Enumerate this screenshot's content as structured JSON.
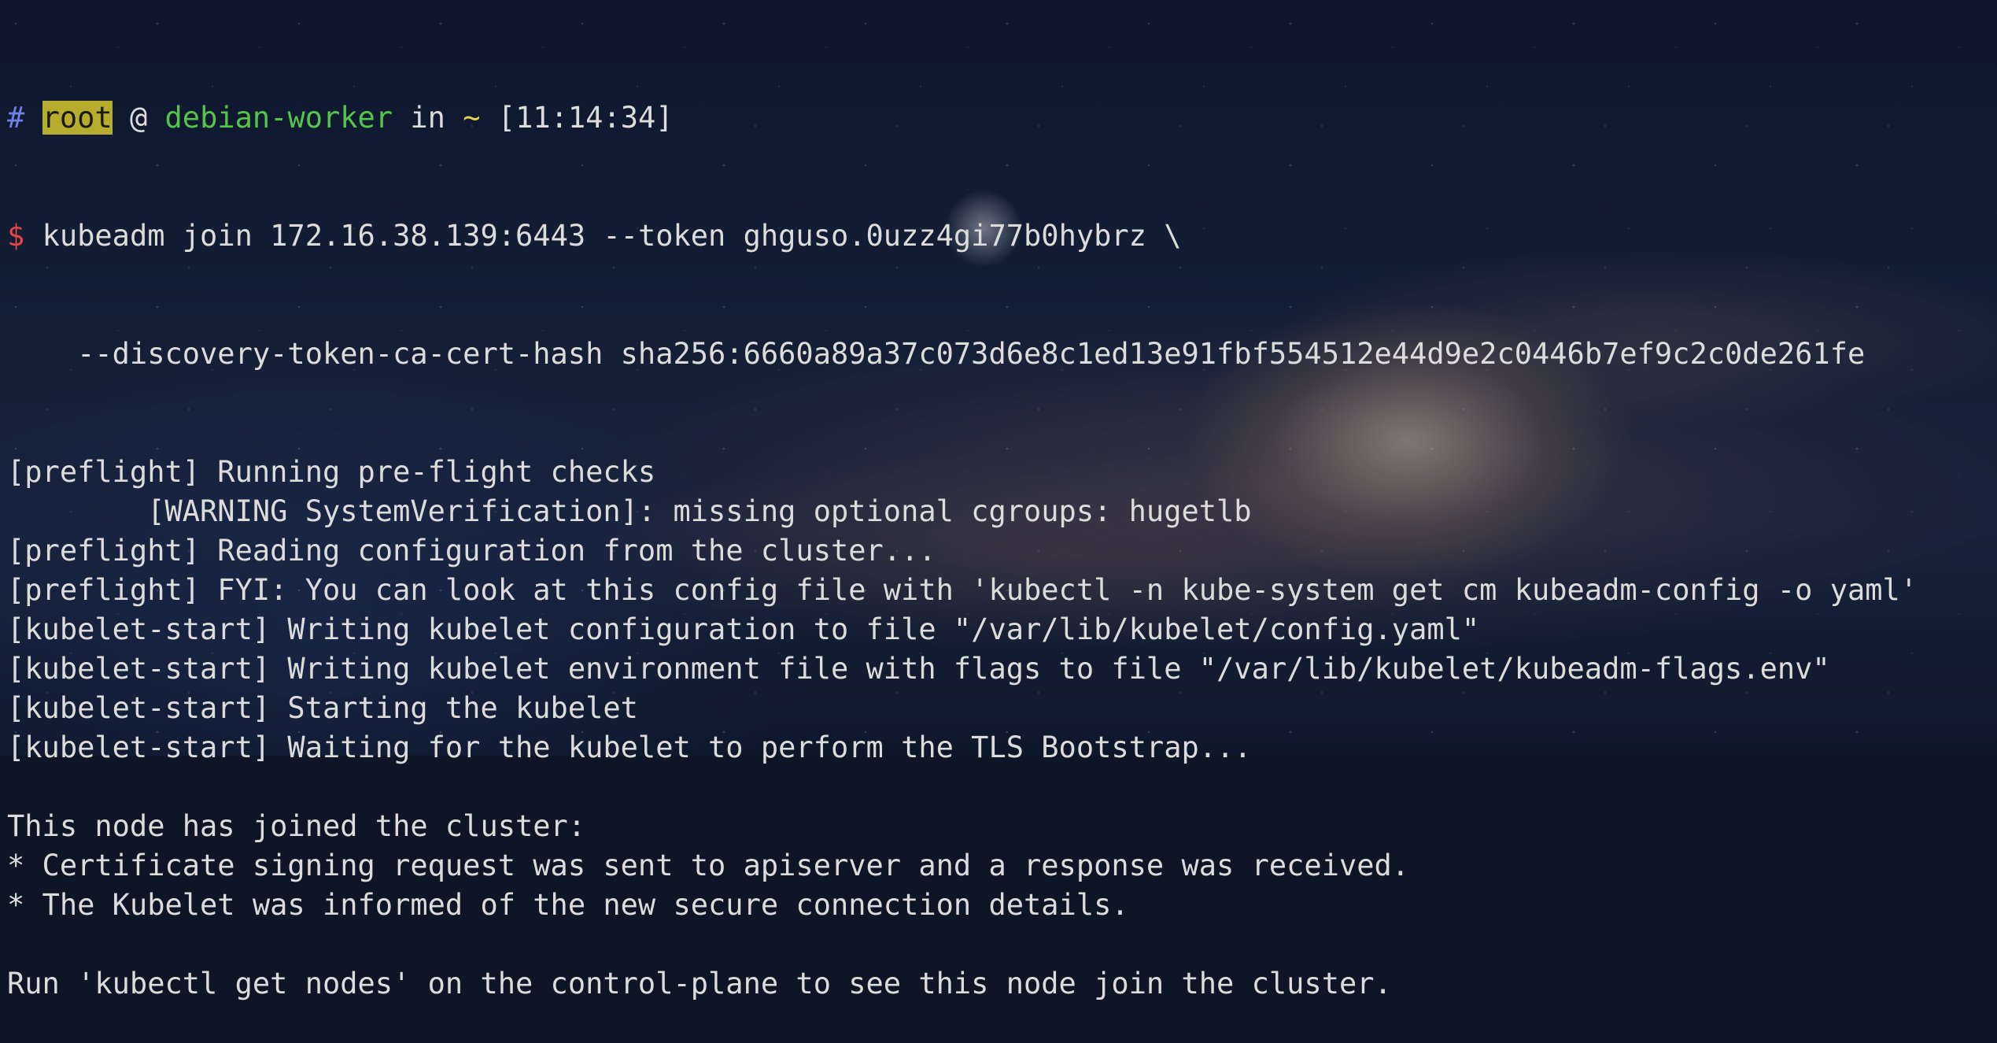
{
  "prompt": {
    "hash": "#",
    "user": "root",
    "at": "@",
    "host": "debian-worker",
    "in_word": "in",
    "dir": "~",
    "time": "[11:14:34]",
    "symbol": "$"
  },
  "command": {
    "line1": "kubeadm join 172.16.38.139:6443 --token ghguso.0uzz4gi77b0hybrz \\",
    "line2": "    --discovery-token-ca-cert-hash sha256:6660a89a37c073d6e8c1ed13e91fbf554512e44d9e2c0446b7ef9c2c0de261fe"
  },
  "output": [
    "[preflight] Running pre-flight checks",
    "        [WARNING SystemVerification]: missing optional cgroups: hugetlb",
    "[preflight] Reading configuration from the cluster...",
    "[preflight] FYI: You can look at this config file with 'kubectl -n kube-system get cm kubeadm-config -o yaml'",
    "[kubelet-start] Writing kubelet configuration to file \"/var/lib/kubelet/config.yaml\"",
    "[kubelet-start] Writing kubelet environment file with flags to file \"/var/lib/kubelet/kubeadm-flags.env\"",
    "[kubelet-start] Starting the kubelet",
    "[kubelet-start] Waiting for the kubelet to perform the TLS Bootstrap...",
    "",
    "This node has joined the cluster:",
    "* Certificate signing request was sent to apiserver and a response was received.",
    "* The Kubelet was informed of the new secure connection details.",
    "",
    "Run 'kubectl get nodes' on the control-plane to see this node join the cluster."
  ],
  "colors": {
    "prompt_hash": "#6f7fe6",
    "user_highlight_bg": "#b6ad2e",
    "host": "#56c44a",
    "dir": "#e6d34a",
    "dollar": "#e04646",
    "text": "#dcdcdc"
  }
}
